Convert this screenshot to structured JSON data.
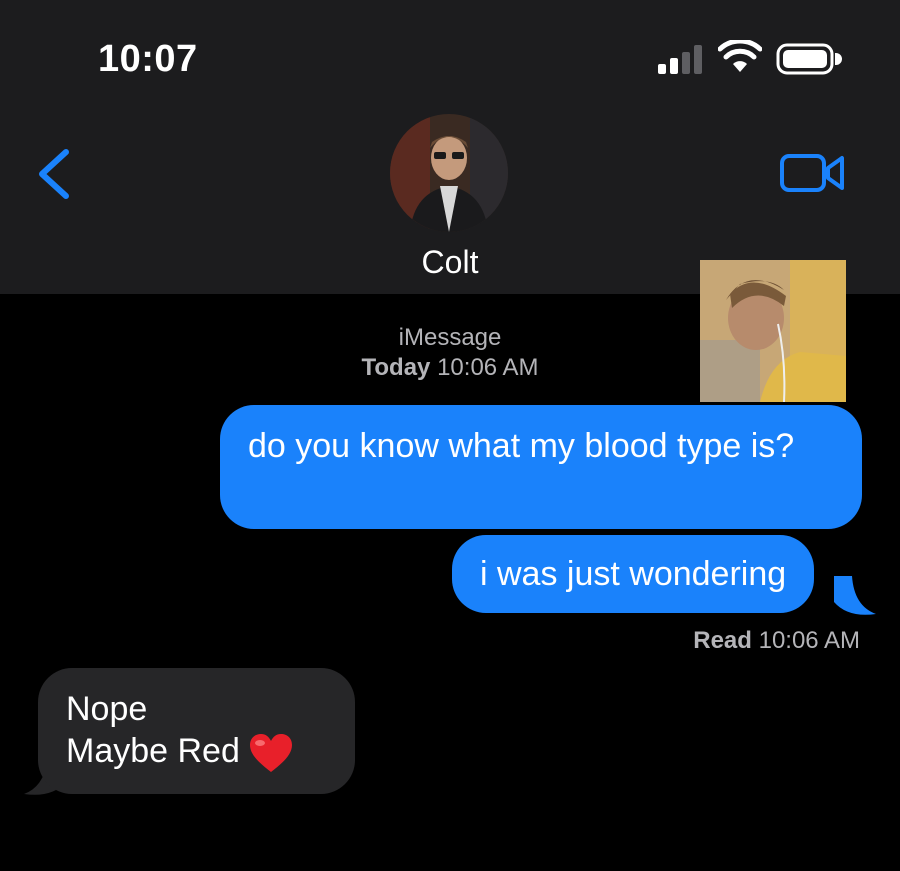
{
  "status_bar": {
    "time": "10:07"
  },
  "nav": {
    "contact_name": "Colt"
  },
  "thread_header": {
    "service": "iMessage",
    "day": "Today",
    "time": "10:06 AM"
  },
  "messages": [
    {
      "direction": "sent",
      "text": "do you know what my blood type is?"
    },
    {
      "direction": "sent",
      "text": "i was just wondering"
    },
    {
      "direction": "received",
      "lines": [
        "Nope",
        "Maybe Red"
      ],
      "emoji": "heart-emoji"
    }
  ],
  "read_receipt": {
    "label": "Read",
    "time": "10:06 AM"
  },
  "colors": {
    "sent_bubble": "#1a82fb",
    "received_bubble": "#262628",
    "accent": "#1a82fb",
    "header_bg": "#1c1c1e"
  }
}
